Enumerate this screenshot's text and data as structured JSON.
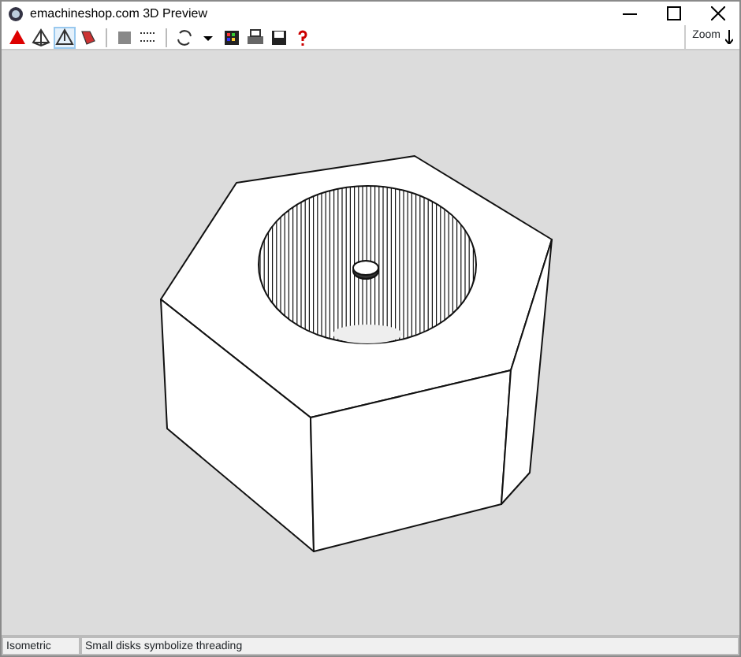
{
  "window": {
    "title": "emachineshop.com 3D Preview"
  },
  "toolbar": {
    "buttons": [
      {
        "kind": "solid",
        "selected": false
      },
      {
        "kind": "wire",
        "selected": false
      },
      {
        "kind": "outline",
        "selected": true
      },
      {
        "kind": "paint",
        "selected": false
      },
      {
        "kind": "sep"
      },
      {
        "kind": "stop",
        "selected": false
      },
      {
        "kind": "grid",
        "selected": false
      },
      {
        "kind": "sep"
      },
      {
        "kind": "rotate",
        "selected": false
      },
      {
        "kind": "dropdown",
        "selected": false
      },
      {
        "kind": "colors",
        "selected": false
      },
      {
        "kind": "print",
        "selected": false
      },
      {
        "kind": "save",
        "selected": false
      },
      {
        "kind": "help",
        "selected": false
      }
    ],
    "zoom_label": "Zoom"
  },
  "status_bar": [
    "Isometric",
    "Small disks symbolize threading"
  ]
}
